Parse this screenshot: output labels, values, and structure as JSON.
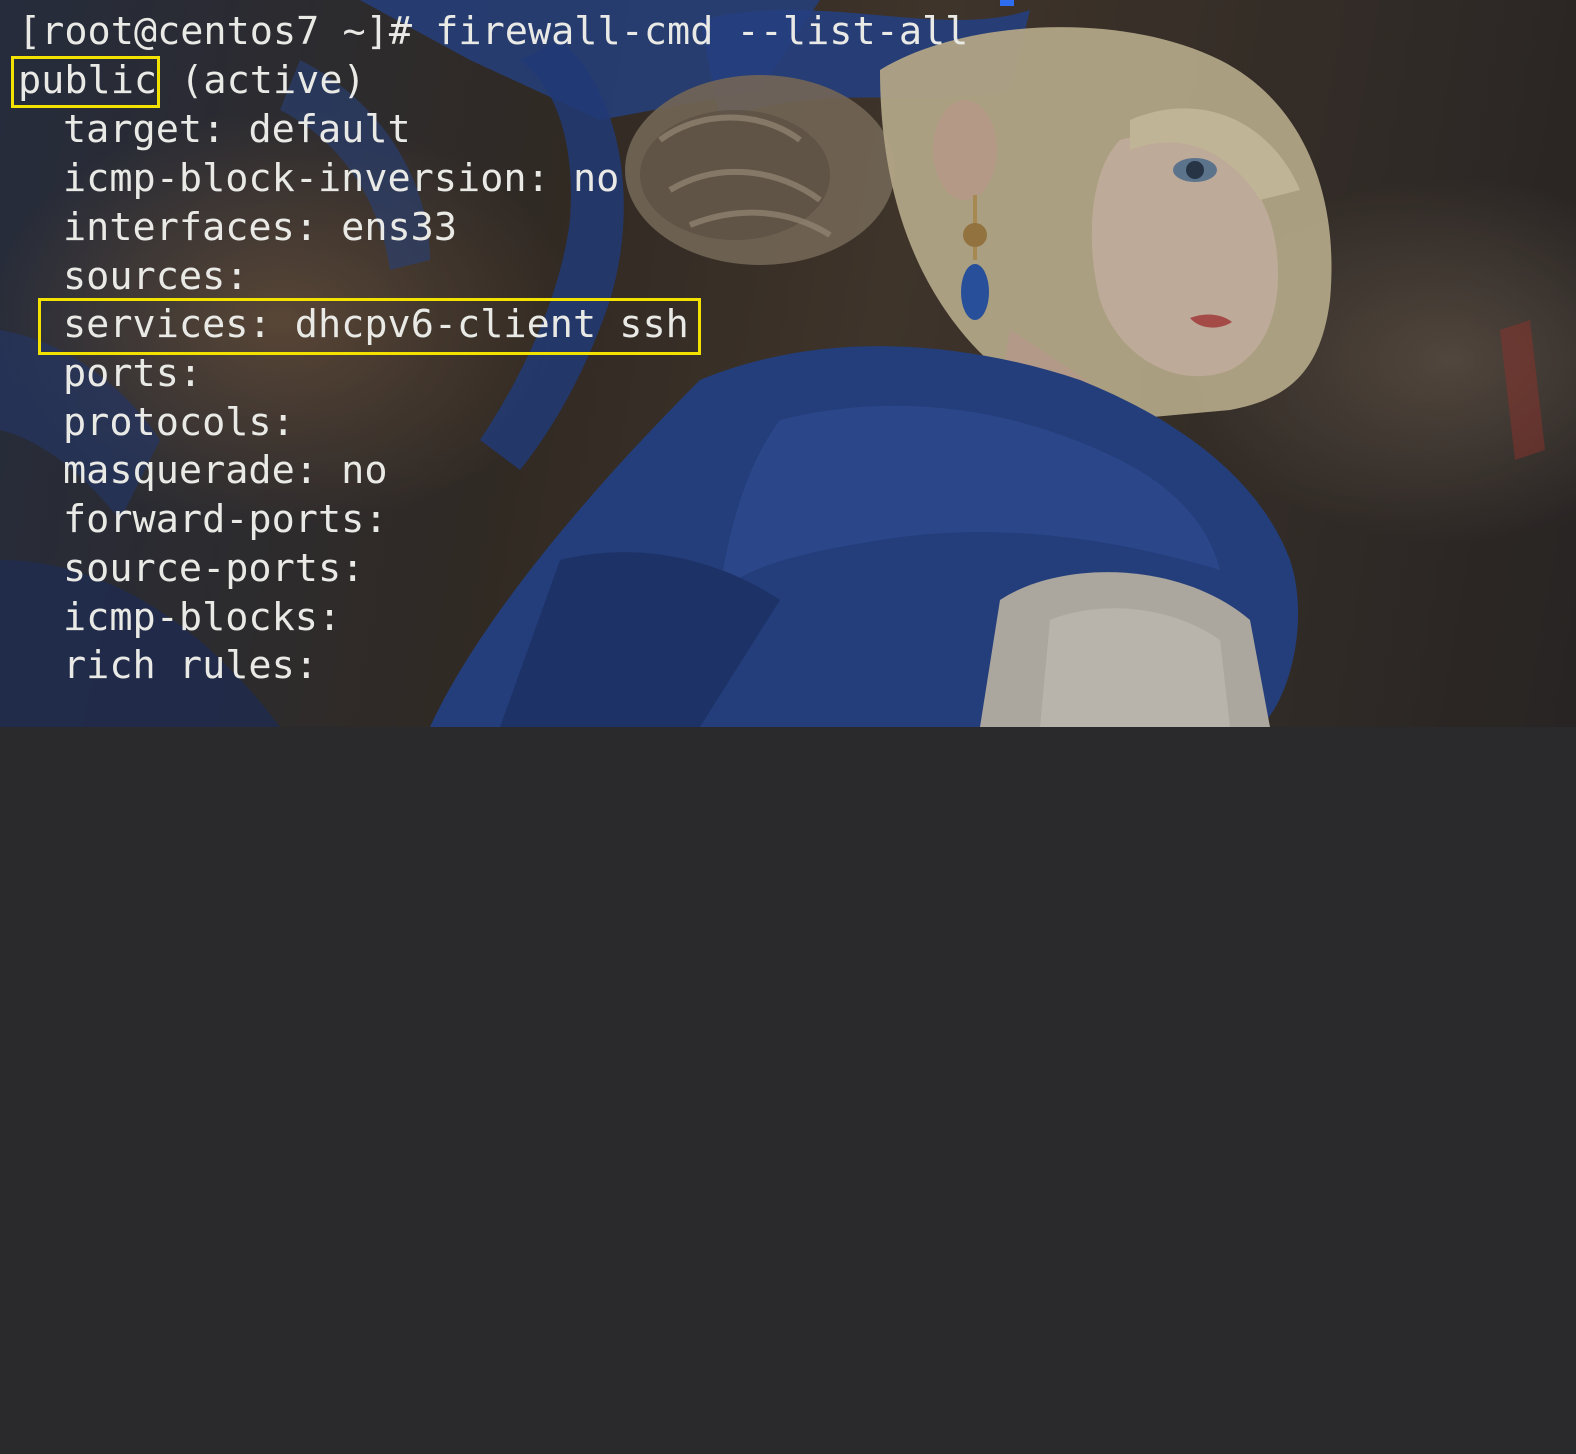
{
  "terminal": {
    "prompt": "[root@centos7 ~]# ",
    "command": "firewall-cmd --list-all",
    "zone_name": "public",
    "zone_status": " (active)",
    "fields": [
      {
        "key": "target:",
        "value": " default"
      },
      {
        "key": "icmp-block-inversion:",
        "value": " no"
      },
      {
        "key": "interfaces:",
        "value": " ens33"
      },
      {
        "key": "sources:",
        "value": ""
      },
      {
        "key": "services:",
        "value": " dhcpv6-client ssh"
      },
      {
        "key": "ports:",
        "value": ""
      },
      {
        "key": "protocols:",
        "value": ""
      },
      {
        "key": "masquerade:",
        "value": " no"
      },
      {
        "key": "forward-ports:",
        "value": ""
      },
      {
        "key": "source-ports:",
        "value": ""
      },
      {
        "key": "icmp-blocks:",
        "value": ""
      },
      {
        "key": "rich rules:",
        "value": ""
      }
    ]
  },
  "colors": {
    "text": "#e9e9e6",
    "highlight_box": "#f3e200",
    "accent_blue": "#2e4f9e"
  },
  "annotations": [
    "zone-name-highlight",
    "services-highlight"
  ]
}
